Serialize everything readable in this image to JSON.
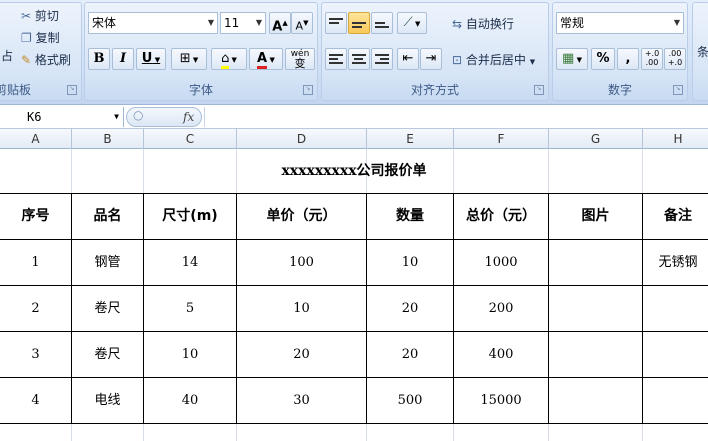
{
  "ribbon": {
    "clipboard": {
      "cut": "剪切",
      "copy": "复制",
      "format_painter": "格式刷",
      "paste_fragment": "占",
      "label": "剪贴板"
    },
    "font": {
      "name": "宋体",
      "size": "11",
      "bold": "B",
      "italic": "I",
      "underline": "U",
      "grow": "A",
      "shrink": "A",
      "font_color_glyph": "A",
      "phonetic": "wén",
      "phonetic_char": "变",
      "label": "字体"
    },
    "alignment": {
      "wrap_text": "自动换行",
      "merge_center": "合并后居中",
      "label": "对齐方式"
    },
    "number": {
      "format": "常规",
      "percent": "%",
      "comma": ",",
      "inc_decimal": "+.0\n.00",
      "dec_decimal": ".00\n+.0",
      "label": "数字"
    },
    "styles_fragment": "条"
  },
  "formula_bar": {
    "name_box": "K6",
    "fx": "fx",
    "formula": ""
  },
  "columns": [
    "A",
    "B",
    "C",
    "D",
    "E",
    "F",
    "G",
    "H"
  ],
  "sheet": {
    "title": "xxxxxxxxx公司报价单",
    "headers": [
      "序号",
      "品名",
      "尺寸(m)",
      "单价（元）",
      "数量",
      "总价（元）",
      "图片",
      "备注"
    ],
    "rows": [
      [
        "1",
        "钢管",
        "14",
        "100",
        "10",
        "1000",
        "",
        "无锈钢"
      ],
      [
        "2",
        "卷尺",
        "5",
        "10",
        "20",
        "200",
        "",
        ""
      ],
      [
        "3",
        "卷尺",
        "10",
        "20",
        "20",
        "400",
        "",
        ""
      ],
      [
        "4",
        "电线",
        "40",
        "30",
        "500",
        "15000",
        "",
        ""
      ]
    ]
  },
  "colors": {
    "accent": "#f9c95a",
    "font_color": "#e02020",
    "highlight": "#ffff00"
  }
}
